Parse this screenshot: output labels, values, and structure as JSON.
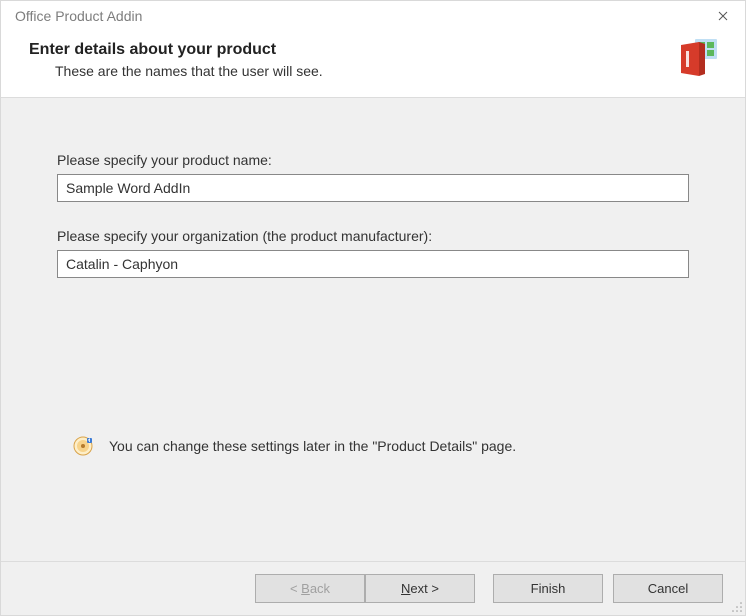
{
  "window": {
    "title": "Office Product Addin"
  },
  "header": {
    "title": "Enter details about your product",
    "subtitle": "These are the names that the user will see."
  },
  "form": {
    "productName": {
      "label": "Please specify your product name:",
      "value": "Sample Word AddIn"
    },
    "organization": {
      "label": "Please specify your organization (the product manufacturer):",
      "value": "Catalin - Caphyon"
    }
  },
  "info": {
    "text": "You can change these settings later in the \"Product Details\" page."
  },
  "buttons": {
    "back": "< Back",
    "next": "Next >",
    "finish": "Finish",
    "cancel": "Cancel"
  }
}
